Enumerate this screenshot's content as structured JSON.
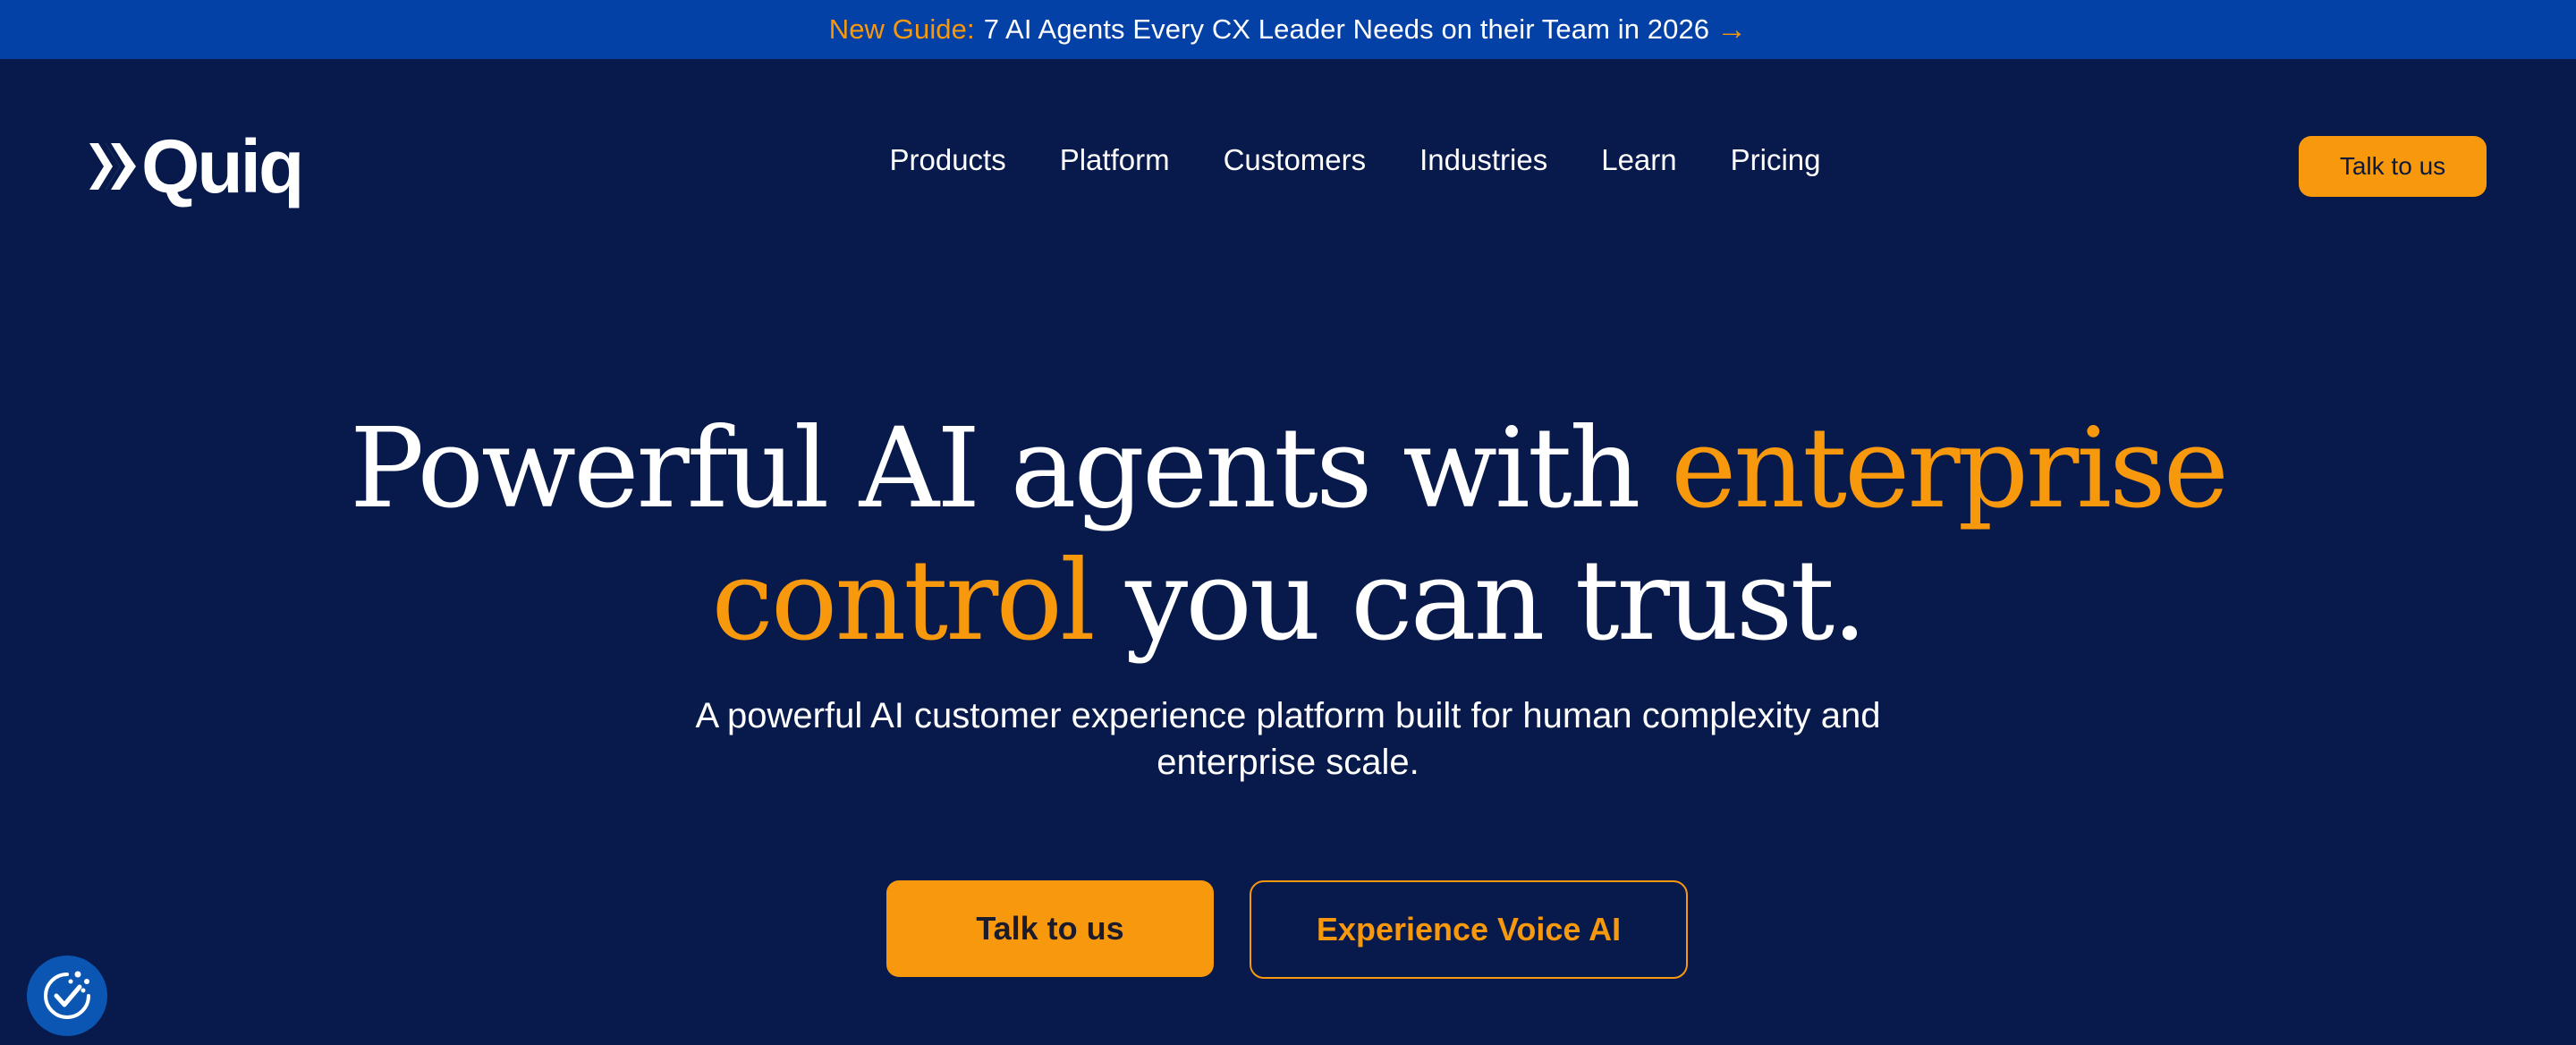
{
  "announcement": {
    "label": "New Guide:",
    "text": "7 AI Agents Every CX Leader Needs on their Team in 2026",
    "icon": "arrow-right-icon"
  },
  "header": {
    "logo_text": "Quiq",
    "nav": [
      {
        "label": "Products"
      },
      {
        "label": "Platform"
      },
      {
        "label": "Customers"
      },
      {
        "label": "Industries"
      },
      {
        "label": "Learn"
      },
      {
        "label": "Pricing"
      }
    ],
    "cta_label": "Talk to us"
  },
  "hero": {
    "headline_part1": "Powerful AI agents with ",
    "headline_accent1": "enterprise",
    "headline_accent2": "control",
    "headline_part2": " you can trust.",
    "subhead": "A powerful AI customer experience platform built for human complexity and enterprise scale.",
    "primary_cta": "Talk to us",
    "secondary_cta": "Experience Voice AI"
  },
  "colors": {
    "background": "#081a4b",
    "announcement_bg": "#0341a7",
    "accent": "#f7980d",
    "text": "#ffffff"
  },
  "widgets": {
    "consent_icon": "cookie-consent-icon"
  }
}
